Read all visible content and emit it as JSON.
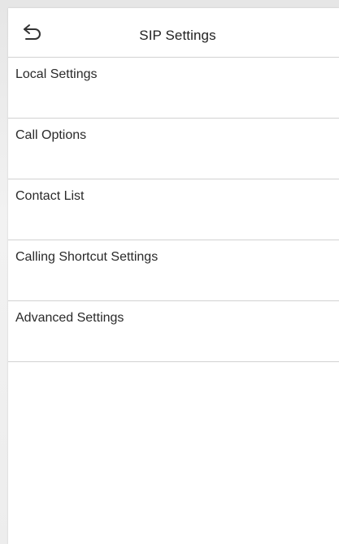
{
  "header": {
    "title": "SIP Settings",
    "back_icon": "back-arrow-icon"
  },
  "menu": {
    "items": [
      {
        "label": "Local Settings"
      },
      {
        "label": "Call Options"
      },
      {
        "label": "Contact List"
      },
      {
        "label": "Calling Shortcut Settings"
      },
      {
        "label": "Advanced Settings"
      }
    ]
  },
  "colors": {
    "background": "#ffffff",
    "divider": "#d2d2d2",
    "text": "#2a2a2a"
  }
}
